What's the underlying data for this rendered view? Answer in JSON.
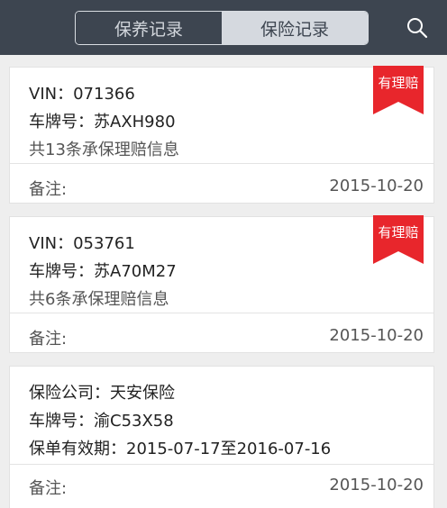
{
  "topbar": {
    "tabs": [
      {
        "label": "保养记录",
        "active": false
      },
      {
        "label": "保险记录",
        "active": true
      }
    ],
    "search_icon": "search-icon"
  },
  "colors": {
    "topbar_bg": "#3d4550",
    "badge_red": "#e8262c"
  },
  "records": [
    {
      "lines": [
        "VIN：071366",
        "车牌号：苏AXH980",
        "共13条承保理赔信息"
      ],
      "badge": "有理赔",
      "note_label": "备注:",
      "date": "2015-10-20"
    },
    {
      "lines": [
        "VIN：053761",
        "车牌号：苏A70M27",
        "共6条承保理赔信息"
      ],
      "badge": "有理赔",
      "note_label": "备注:",
      "date": "2015-10-20"
    },
    {
      "lines": [
        "保险公司：天安保险",
        "车牌号：渝C53X58",
        "保单有效期：2015-07-17至2016-07-16"
      ],
      "note_label": "备注:",
      "date": "2015-10-20"
    }
  ]
}
